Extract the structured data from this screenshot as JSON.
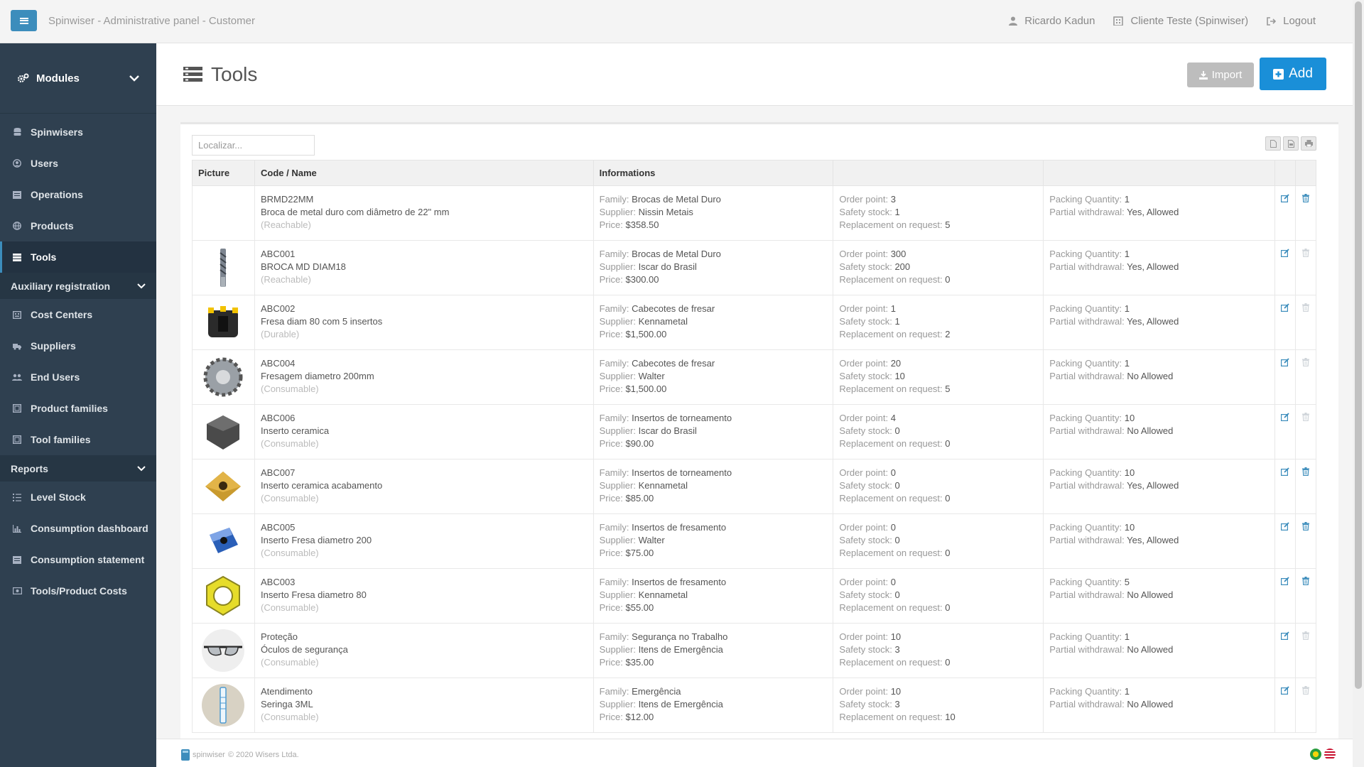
{
  "header": {
    "title": "Spinwiser - Administrative panel - Customer",
    "user": "Ricardo Kadun",
    "company": "Cliente Teste (Spinwiser)",
    "logout": "Logout"
  },
  "sidebar": {
    "modules": "Modules",
    "items": [
      {
        "label": "Spinwisers",
        "icon": "database-icon"
      },
      {
        "label": "Users",
        "icon": "user-circle-icon"
      },
      {
        "label": "Operations",
        "icon": "list-icon"
      },
      {
        "label": "Products",
        "icon": "globe-icon"
      },
      {
        "label": "Tools",
        "icon": "tools-icon"
      }
    ],
    "aux_group": "Auxiliary registration",
    "aux_items": [
      {
        "label": "Cost Centers",
        "icon": "building-icon"
      },
      {
        "label": "Suppliers",
        "icon": "truck-icon"
      },
      {
        "label": "End Users",
        "icon": "users-icon"
      },
      {
        "label": "Product families",
        "icon": "sitemap-icon"
      },
      {
        "label": "Tool families",
        "icon": "sitemap-icon"
      }
    ],
    "reports_group": "Reports",
    "report_items": [
      {
        "label": "Level Stock",
        "icon": "list-ordered-icon"
      },
      {
        "label": "Consumption dashboard",
        "icon": "bar-chart-icon"
      },
      {
        "label": "Consumption statement",
        "icon": "list-icon"
      },
      {
        "label": "Tools/Product Costs",
        "icon": "money-icon"
      }
    ]
  },
  "page": {
    "title": "Tools",
    "import_label": "Import",
    "add_label": "Add",
    "search_placeholder": "Localizar..."
  },
  "table": {
    "headers": [
      "Picture",
      "Code / Name",
      "Informations",
      "",
      "",
      "",
      ""
    ],
    "labels": {
      "family": "Family:",
      "supplier": "Supplier:",
      "price": "Price:",
      "order_point": "Order point:",
      "safety_stock": "Safety stock:",
      "replacement": "Replacement on request:",
      "packing": "Packing Quantity:",
      "partial": "Partial withdrawal:"
    },
    "rows": [
      {
        "picture": "none",
        "code": "BRMD22MM",
        "name": "Broca de metal duro com diâmetro de 22\" mm",
        "type": "(Reachable)",
        "family": "Brocas de Metal Duro",
        "supplier": "Nissin Metais",
        "price": "$358.50",
        "order_point": "3",
        "safety_stock": "1",
        "replacement": "5",
        "packing": "1",
        "partial": "Yes, Allowed",
        "delete_enabled": true
      },
      {
        "picture": "drill-bit",
        "code": "ABC001",
        "name": "BROCA MD DIAM18",
        "type": "(Reachable)",
        "family": "Brocas de Metal Duro",
        "supplier": "Iscar do Brasil",
        "price": "$300.00",
        "order_point": "300",
        "safety_stock": "200",
        "replacement": "0",
        "packing": "1",
        "partial": "Yes, Allowed",
        "delete_enabled": false
      },
      {
        "picture": "milling-head",
        "code": "ABC002",
        "name": "Fresa diam 80 com 5 insertos",
        "type": "(Durable)",
        "family": "Cabecotes de fresar",
        "supplier": "Kennametal",
        "price": "$1,500.00",
        "order_point": "1",
        "safety_stock": "1",
        "replacement": "2",
        "packing": "1",
        "partial": "Yes, Allowed",
        "delete_enabled": false
      },
      {
        "picture": "milling-cutter",
        "code": "ABC004",
        "name": "Fresagem diametro 200mm",
        "type": "(Consumable)",
        "family": "Cabecotes de fresar",
        "supplier": "Walter",
        "price": "$1,500.00",
        "order_point": "20",
        "safety_stock": "10",
        "replacement": "5",
        "packing": "1",
        "partial": "No Allowed",
        "delete_enabled": false
      },
      {
        "picture": "ceramic-insert",
        "code": "ABC006",
        "name": "Inserto ceramica",
        "type": "(Consumable)",
        "family": "Insertos de torneamento",
        "supplier": "Iscar do Brasil",
        "price": "$90.00",
        "order_point": "4",
        "safety_stock": "0",
        "replacement": "0",
        "packing": "10",
        "partial": "No Allowed",
        "delete_enabled": false
      },
      {
        "picture": "gold-insert",
        "code": "ABC007",
        "name": "Inserto ceramica acabamento",
        "type": "(Consumable)",
        "family": "Insertos de torneamento",
        "supplier": "Kennametal",
        "price": "$85.00",
        "order_point": "0",
        "safety_stock": "0",
        "replacement": "0",
        "packing": "10",
        "partial": "Yes, Allowed",
        "delete_enabled": true
      },
      {
        "picture": "blue-insert",
        "code": "ABC005",
        "name": "Inserto Fresa diametro 200",
        "type": "(Consumable)",
        "family": "Insertos de fresamento",
        "supplier": "Walter",
        "price": "$75.00",
        "order_point": "0",
        "safety_stock": "0",
        "replacement": "0",
        "packing": "10",
        "partial": "Yes, Allowed",
        "delete_enabled": true
      },
      {
        "picture": "yellow-insert",
        "code": "ABC003",
        "name": "Inserto Fresa diametro 80",
        "type": "(Consumable)",
        "family": "Insertos de fresamento",
        "supplier": "Kennametal",
        "price": "$55.00",
        "order_point": "0",
        "safety_stock": "0",
        "replacement": "0",
        "packing": "5",
        "partial": "No Allowed",
        "delete_enabled": true
      },
      {
        "picture": "safety-glasses",
        "code": "Proteção",
        "name": "Óculos de segurança",
        "type": "(Consumable)",
        "family": "Segurança no Trabalho",
        "supplier": "Itens de Emergência",
        "price": "$35.00",
        "order_point": "10",
        "safety_stock": "3",
        "replacement": "0",
        "packing": "1",
        "partial": "No Allowed",
        "delete_enabled": false
      },
      {
        "picture": "syringe",
        "code": "Atendimento",
        "name": "Seringa 3ML",
        "type": "(Consumable)",
        "family": "Emergência",
        "supplier": "Itens de Emergência",
        "price": "$12.00",
        "order_point": "10",
        "safety_stock": "3",
        "replacement": "10",
        "packing": "1",
        "partial": "No Allowed",
        "delete_enabled": false
      }
    ]
  },
  "footer": {
    "brand": "spinwiser",
    "copyright": "© 2020 Wisers Ltda."
  },
  "colors": {
    "sidebar": "#2f4050",
    "primary": "#1a8fd8",
    "toggle": "#3c8dbc"
  }
}
